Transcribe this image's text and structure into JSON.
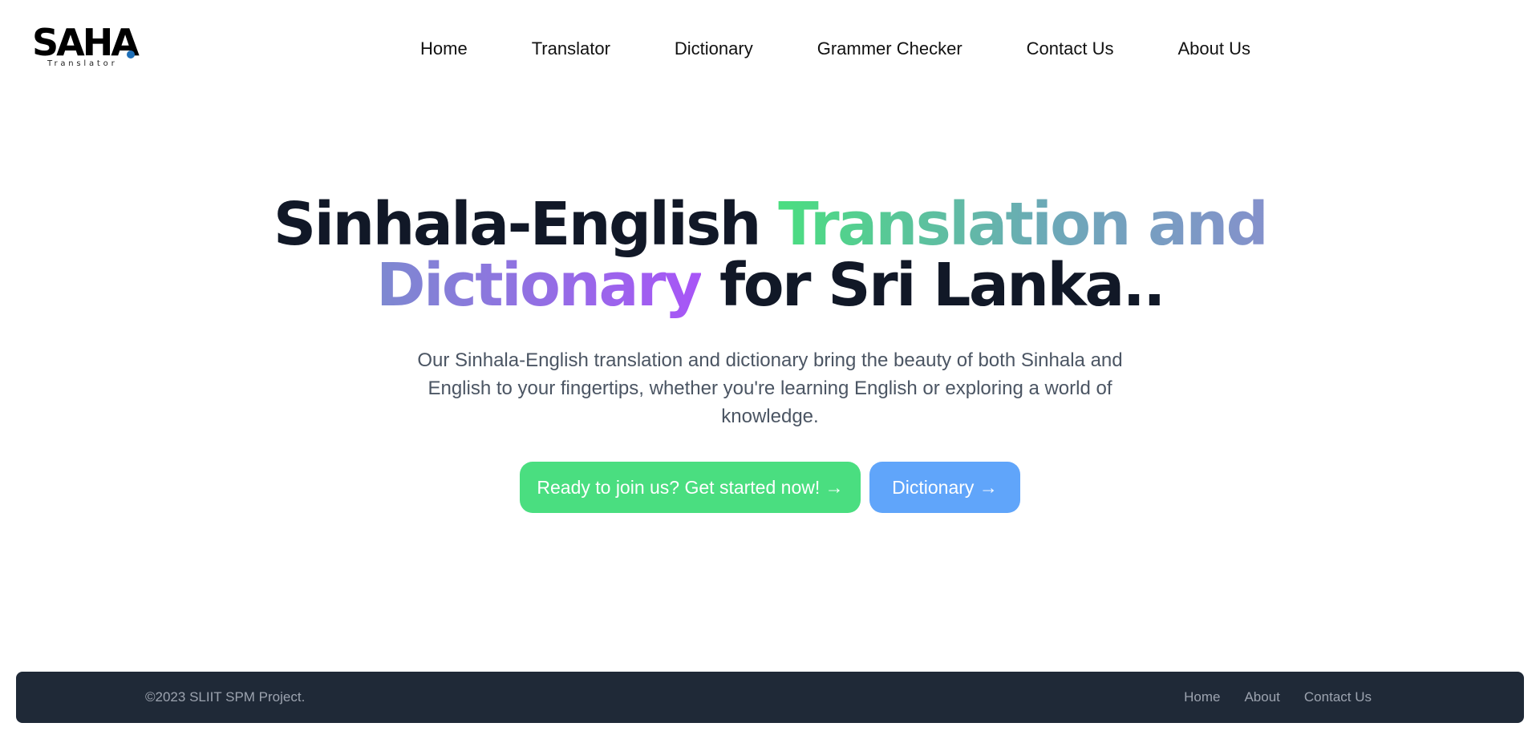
{
  "brand": {
    "name": "SAHA",
    "tagline": "Translator",
    "dot_color": "#1e6fb8"
  },
  "nav": {
    "items": [
      {
        "label": "Home"
      },
      {
        "label": "Translator"
      },
      {
        "label": "Dictionary"
      },
      {
        "label": "Grammer Checker"
      },
      {
        "label": "Contact Us"
      },
      {
        "label": "About Us"
      }
    ]
  },
  "hero": {
    "title_part1": "Sinhala-English ",
    "title_highlight1": "Translation and",
    "title_highlight2": "Dictionary",
    "title_part2": " for Sri Lanka..",
    "description": "Our Sinhala-English translation and dictionary bring the beauty of both Sinhala and English to your fingertips, whether you're learning English or exploring a world of knowledge.",
    "primary_button": "Ready to join us? Get started now! →",
    "secondary_button": "Dictionary →"
  },
  "colors": {
    "primary_button": "#4ade80",
    "secondary_button": "#60a5fa",
    "footer_bg": "#1f2937"
  },
  "footer": {
    "copyright": "©2023 SLIIT SPM Project.",
    "links": [
      {
        "label": "Home"
      },
      {
        "label": "About"
      },
      {
        "label": "Contact Us"
      }
    ]
  }
}
